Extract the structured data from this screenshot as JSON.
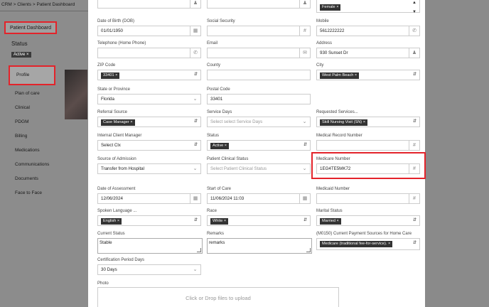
{
  "breadcrumb": "CRM > Clients > Patient Dashboard",
  "sidebar": {
    "dashboard_label": "Patient Dashboard",
    "status_label": "Status",
    "status_tag": "Active ×",
    "items": [
      "Profile",
      "Plan of care",
      "Clinical",
      "PDGM",
      "Billing",
      "Medications",
      "Communications",
      "Documents",
      "Face to Face"
    ]
  },
  "form": {
    "gender_tag": "Female ×",
    "dob": {
      "label": "Date of Birth (DOB)",
      "value": "01/01/1950"
    },
    "ssn": {
      "label": "Social Security",
      "value": ""
    },
    "mobile": {
      "label": "Mobile",
      "value": "5612222222"
    },
    "home_phone": {
      "label": "Telephone (Home Phone)",
      "value": ""
    },
    "email": {
      "label": "Email",
      "value": ""
    },
    "address": {
      "label": "Address",
      "value": "930 Sunset Dr"
    },
    "zip": {
      "label": "ZIP Code",
      "tag": "33401 ×"
    },
    "county": {
      "label": "County",
      "value": ""
    },
    "city": {
      "label": "City",
      "tag": "West Palm Beach ×"
    },
    "state": {
      "label": "State or Province",
      "value": "Florida"
    },
    "postal": {
      "label": "Postal Code",
      "value": "33401"
    },
    "referral": {
      "label": "Referral Source",
      "tag": "Case Manager ×"
    },
    "service_days": {
      "label": "Service Days",
      "placeholder": "Select select Service Days"
    },
    "requested": {
      "label": "Requested Services...",
      "tag": "Skill Nursing Visit (SN) ×"
    },
    "manager": {
      "label": "Internal Client Manager",
      "value": "Select Clx"
    },
    "status": {
      "label": "Status",
      "tag": "Active ×"
    },
    "mrn": {
      "label": "Medical Record Number",
      "value": ""
    },
    "admission": {
      "label": "Source of Admission",
      "value": "Transfer from Hospital"
    },
    "clinical_status": {
      "label": "Patient Clinical Status",
      "placeholder": "Select Patient Clinical Status"
    },
    "medicare": {
      "label": "Medicare Number",
      "value": "1EG4TE5MK72"
    },
    "assessment": {
      "label": "Date of Assessment",
      "value": "12/06/2024"
    },
    "start_care": {
      "label": "Start of Care",
      "value": "11/06/2024 11:03"
    },
    "medicaid": {
      "label": "Medicaid Number",
      "value": ""
    },
    "language": {
      "label": "Spoken Language ...",
      "tag": "English ×"
    },
    "race": {
      "label": "Race",
      "tag": "White ×"
    },
    "marital": {
      "label": "Marital Status",
      "tag": "Married ×"
    },
    "current_status": {
      "label": "Current Status",
      "value": "Stable"
    },
    "remarks": {
      "label": "Remarks",
      "value": "remarks"
    },
    "payment": {
      "label": "(M0150) Current Payment Sources for Home Care",
      "tag": "Medicare (traditional fee-for-service). ×"
    },
    "cert_period": {
      "label": "Certification Period Days",
      "value": "30 Days"
    },
    "photo": {
      "label": "Photo",
      "drop_text": "Click or Drop files to upload"
    }
  },
  "icons": {
    "calendar": "calendar-icon",
    "hash": "hash-icon",
    "phone": "phone-icon",
    "mail": "mail-icon",
    "person": "person-icon"
  }
}
